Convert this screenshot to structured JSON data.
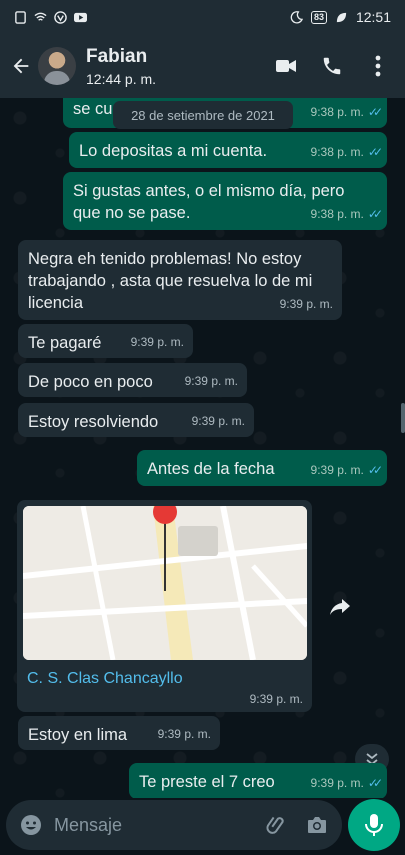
{
  "statusbar": {
    "battery": "83",
    "time": "12:51"
  },
  "header": {
    "contact_name": "Fabian",
    "contact_status": "12:44 p. m."
  },
  "chat": {
    "date_chip": "28 de setiembre de 2021",
    "messages": [
      {
        "text": "se cu",
        "time": "9:38 p. m.",
        "dir": "out"
      },
      {
        "text": "Lo depositas a mi cuenta.",
        "time": "9:38 p. m.",
        "dir": "out"
      },
      {
        "text": "Si gustas antes, o el mismo día, pero que no se pase.",
        "time": "9:38 p. m.",
        "dir": "out"
      },
      {
        "text": "Negra eh tenido problemas! No estoy trabajando , asta que resuelva lo de mi licencia",
        "time": "9:39 p. m.",
        "dir": "in"
      },
      {
        "text": "Te pagaré",
        "time": "9:39 p. m.",
        "dir": "in"
      },
      {
        "text": "De poco en poco",
        "time": "9:39 p. m.",
        "dir": "in"
      },
      {
        "text": "Estoy resolviendo",
        "time": "9:39 p. m.",
        "dir": "in"
      },
      {
        "text": "Antes de la fecha",
        "time": "9:39 p. m.",
        "dir": "out"
      },
      {
        "text": "C. S. Clas Chancayllo",
        "time": "9:39 p. m.",
        "dir": "in",
        "type": "location"
      },
      {
        "text": "Estoy en lima",
        "time": "9:39 p. m.",
        "dir": "in"
      },
      {
        "text": "Te preste el 7 creo",
        "time": "9:39 p. m.",
        "dir": "out"
      }
    ]
  },
  "composer": {
    "placeholder": "Mensaje"
  },
  "colors": {
    "header": "#1f2c34",
    "outgoing": "#005c4b",
    "incoming": "#1f2c34",
    "accent": "#00a884",
    "ticks": "#53bdeb"
  },
  "icons": [
    "back-arrow-icon",
    "video-call-icon",
    "phone-icon",
    "more-icon",
    "forward-icon",
    "chevron-down-icon",
    "emoji-icon",
    "attach-icon",
    "camera-icon",
    "mic-icon"
  ]
}
